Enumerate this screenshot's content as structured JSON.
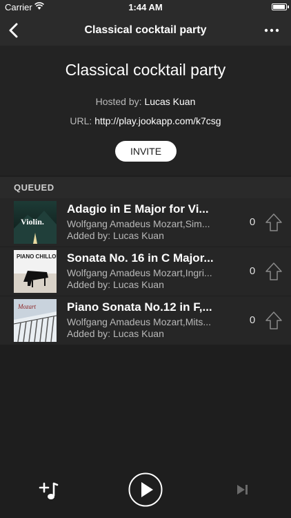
{
  "status_bar": {
    "carrier": "Carrier",
    "time": "1:44 AM"
  },
  "nav": {
    "title": "Classical cocktail party"
  },
  "party": {
    "title": "Classical cocktail party",
    "hosted_by_label": "Hosted by:",
    "host": "Lucas Kuan",
    "url_label": "URL:",
    "url": "http://play.jookapp.com/k7csg",
    "invite_label": "INVITE"
  },
  "queue": {
    "section_label": "QUEUED",
    "tracks": [
      {
        "name": "Adagio in E Major for Vi...",
        "artist": "Wolfgang Amadeus Mozart,Sim...",
        "added_by": "Added by: Lucas Kuan",
        "votes": "0",
        "art_text": "Violin."
      },
      {
        "name": "Sonata No. 16 in C Major...",
        "artist": "Wolfgang Amadeus Mozart,Ingri...",
        "added_by": "Added by: Lucas Kuan",
        "votes": "0",
        "art_text": "PIANO CHILLOUT"
      },
      {
        "name": "Piano Sonata No.12 in F,...",
        "artist": "Wolfgang Amadeus Mozart,Mits...",
        "added_by": "Added by: Lucas Kuan",
        "votes": "0",
        "art_text": "Mozart"
      }
    ]
  },
  "player": {
    "add_icon": "add-song-icon",
    "play_icon": "play-icon",
    "next_icon": "skip-next-icon"
  },
  "colors": {
    "background": "#1e1e1e",
    "bar": "#2b2b2b",
    "accent": "#ffffff",
    "muted_text": "#b9b9b9"
  }
}
